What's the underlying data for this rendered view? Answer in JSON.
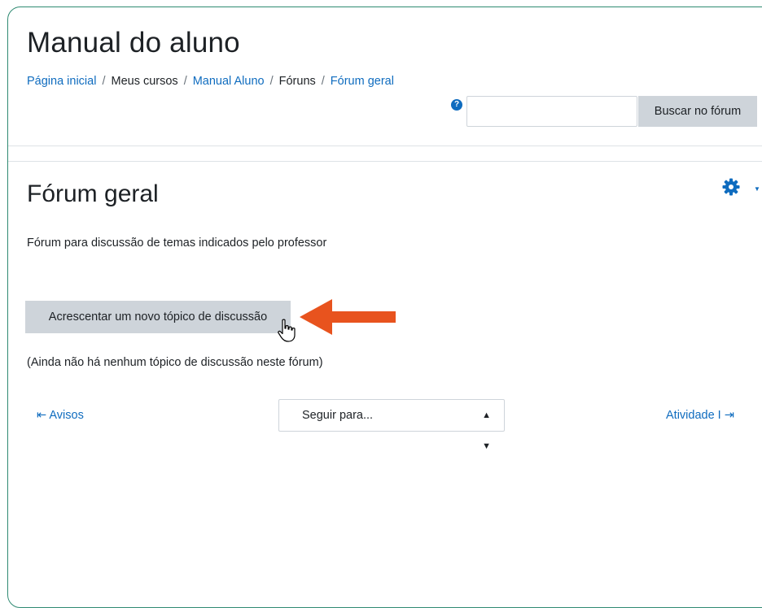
{
  "header": {
    "title": "Manual do aluno",
    "breadcrumb": [
      {
        "label": "Página inicial",
        "link": true
      },
      {
        "label": "Meus cursos",
        "link": false
      },
      {
        "label": "Manual Aluno",
        "link": true
      },
      {
        "label": "Fóruns",
        "link": false
      },
      {
        "label": "Fórum geral",
        "link": true
      }
    ],
    "breadcrumb_separator": "/",
    "help_icon": "question-circle-icon",
    "search_value": "",
    "search_button": "Buscar no fórum"
  },
  "main": {
    "settings_icon": "gear-icon",
    "forum_title": "Fórum geral",
    "intro": "Fórum para discussão de temas indicados pelo professor",
    "add_button": "Acrescentar um novo tópico de discussão",
    "empty_note": "(Ainda não há nenhum tópico de discussão neste fórum)"
  },
  "navigation": {
    "prev_label": "Avisos",
    "jump_select_value": "Seguir para...",
    "next_label": "Atividade I"
  },
  "colors": {
    "frame_border": "#2f8a72",
    "link": "#0f6cbf",
    "button_bg": "#ced4da",
    "annotation_arrow": "#e8531e"
  }
}
